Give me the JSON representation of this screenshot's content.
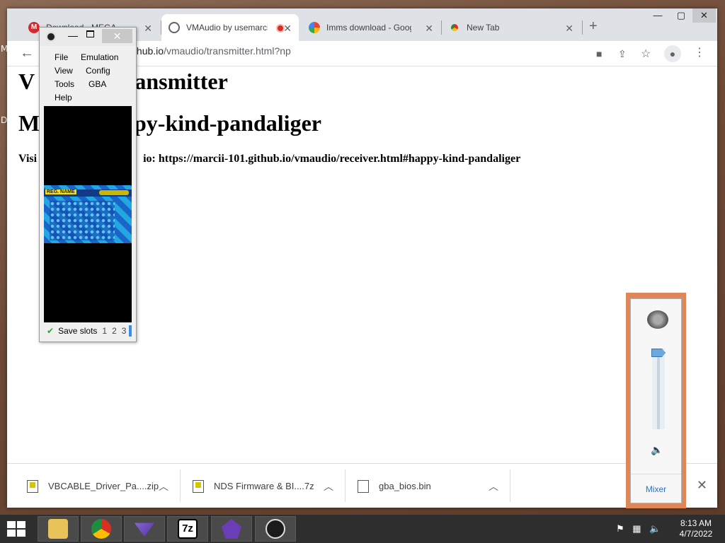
{
  "desktop": {
    "labels": [
      "M",
      "D"
    ]
  },
  "chrome": {
    "tabs": [
      {
        "title": "Download - MEGA",
        "favicon": "mega-icon",
        "active": false
      },
      {
        "title": "VMAudio by usemarcii",
        "favicon": "globe-icon",
        "active": true,
        "recording": true
      },
      {
        "title": "Imms download - Google",
        "favicon": "google-icon",
        "active": false
      },
      {
        "title": "New Tab",
        "favicon": "chrome-icon",
        "active": false
      }
    ],
    "new_tab": "+",
    "window_controls": {
      "minimize": "—",
      "maximize": "▢",
      "close": "✕"
    },
    "address": {
      "host": "marcii-101.github.io",
      "path": "/vmaudio/transmitter.html?np",
      "visible_text_prefix": "ii-101.github.io"
    },
    "toolbar_icons": [
      "camera-icon",
      "share-icon",
      "star-icon",
      "profile-icon",
      "menu-dots-icon"
    ]
  },
  "page": {
    "heading1": "VMAudio Transmitter",
    "heading1_visible_part": "ransmitter",
    "heading1_hidden_part": "V",
    "heading2": "My ID: happy-kind-pandaliger",
    "heading2_visible_part": "ppy-kind-pandaliger",
    "heading2_hidden_part": "M",
    "visit_text": "Visit this link to hear the audio: https://marcii-101.github.io/vmaudio/receiver.html#happy-kind-pandaliger",
    "visit_visible_prefix": "Visi",
    "visit_visible_suffix": "io: https://marcii-101.github.io/vmaudio/receiver.html#happy-kind-pandaliger"
  },
  "downloads": [
    {
      "name": "VBCABLE_Driver_Pa....zip",
      "type": "zip"
    },
    {
      "name": "NDS Firmware & BI....7z",
      "type": "zip"
    },
    {
      "name": "gba_bios.bin",
      "type": "file"
    }
  ],
  "downloads_close": "✕",
  "emulator": {
    "menus": [
      "File",
      "Emulation",
      "View",
      "Config",
      "Tools",
      "GBA",
      "Help"
    ],
    "game_label": "REG. NAME",
    "status": {
      "label": "Save slots",
      "slots": [
        "1",
        "2",
        "3"
      ]
    },
    "close": "✕"
  },
  "volume_flyout": {
    "mixer_label": "Mixer",
    "level": 1.0
  },
  "taskbar": {
    "apps": [
      "file-explorer",
      "chrome",
      "dolphin-emulator",
      "7zip",
      "desmume",
      "obs"
    ],
    "clock_time": "8:13 AM",
    "clock_date": "4/7/2022"
  }
}
